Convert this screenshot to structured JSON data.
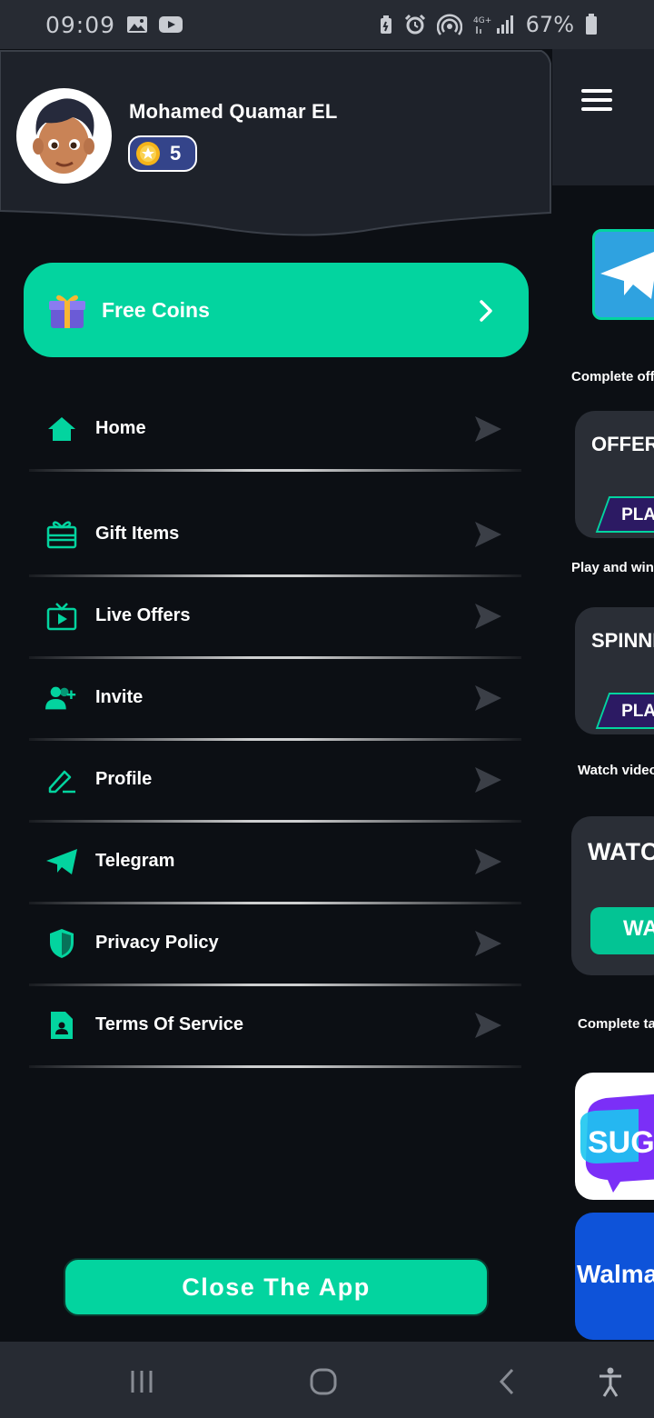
{
  "status_bar": {
    "time": "09:09",
    "network": "4G+",
    "battery": "67%"
  },
  "drawer": {
    "user_name": "Mohamed Quamar EL",
    "coins": "5",
    "free_coins_label": "Free Coins",
    "menu": [
      {
        "label": "Home",
        "icon": "home-icon"
      },
      {
        "label": "Gift Items",
        "icon": "gift-card-icon"
      },
      {
        "label": "Live Offers",
        "icon": "tv-icon"
      },
      {
        "label": "Invite",
        "icon": "add-user-icon"
      },
      {
        "label": "Profile",
        "icon": "edit-icon"
      },
      {
        "label": "Telegram",
        "icon": "telegram-icon"
      },
      {
        "label": "Privacy Policy",
        "icon": "shield-icon"
      },
      {
        "label": "Terms Of Service",
        "icon": "document-icon"
      }
    ],
    "close_label": "Close The App"
  },
  "background_app": {
    "complete_offers_text": "Complete offe",
    "offerwall_title": "OFFERW",
    "play_label_1": "PLA",
    "play_win_text": "Play and win",
    "spinning_title": "SPINNI",
    "play_label_2": "PLA",
    "watch_video_text": "Watch video",
    "watch_title": "WATC",
    "watch_btn_label": "WA",
    "complete_tasks_text": "Complete ta",
    "sugo_label": "SUG",
    "walmart_label": "Walmar"
  },
  "colors": {
    "accent": "#03d49f",
    "drawer_bg": "#0c0f14",
    "header_bg": "#1e222a",
    "coin_badge": "#34448a"
  }
}
